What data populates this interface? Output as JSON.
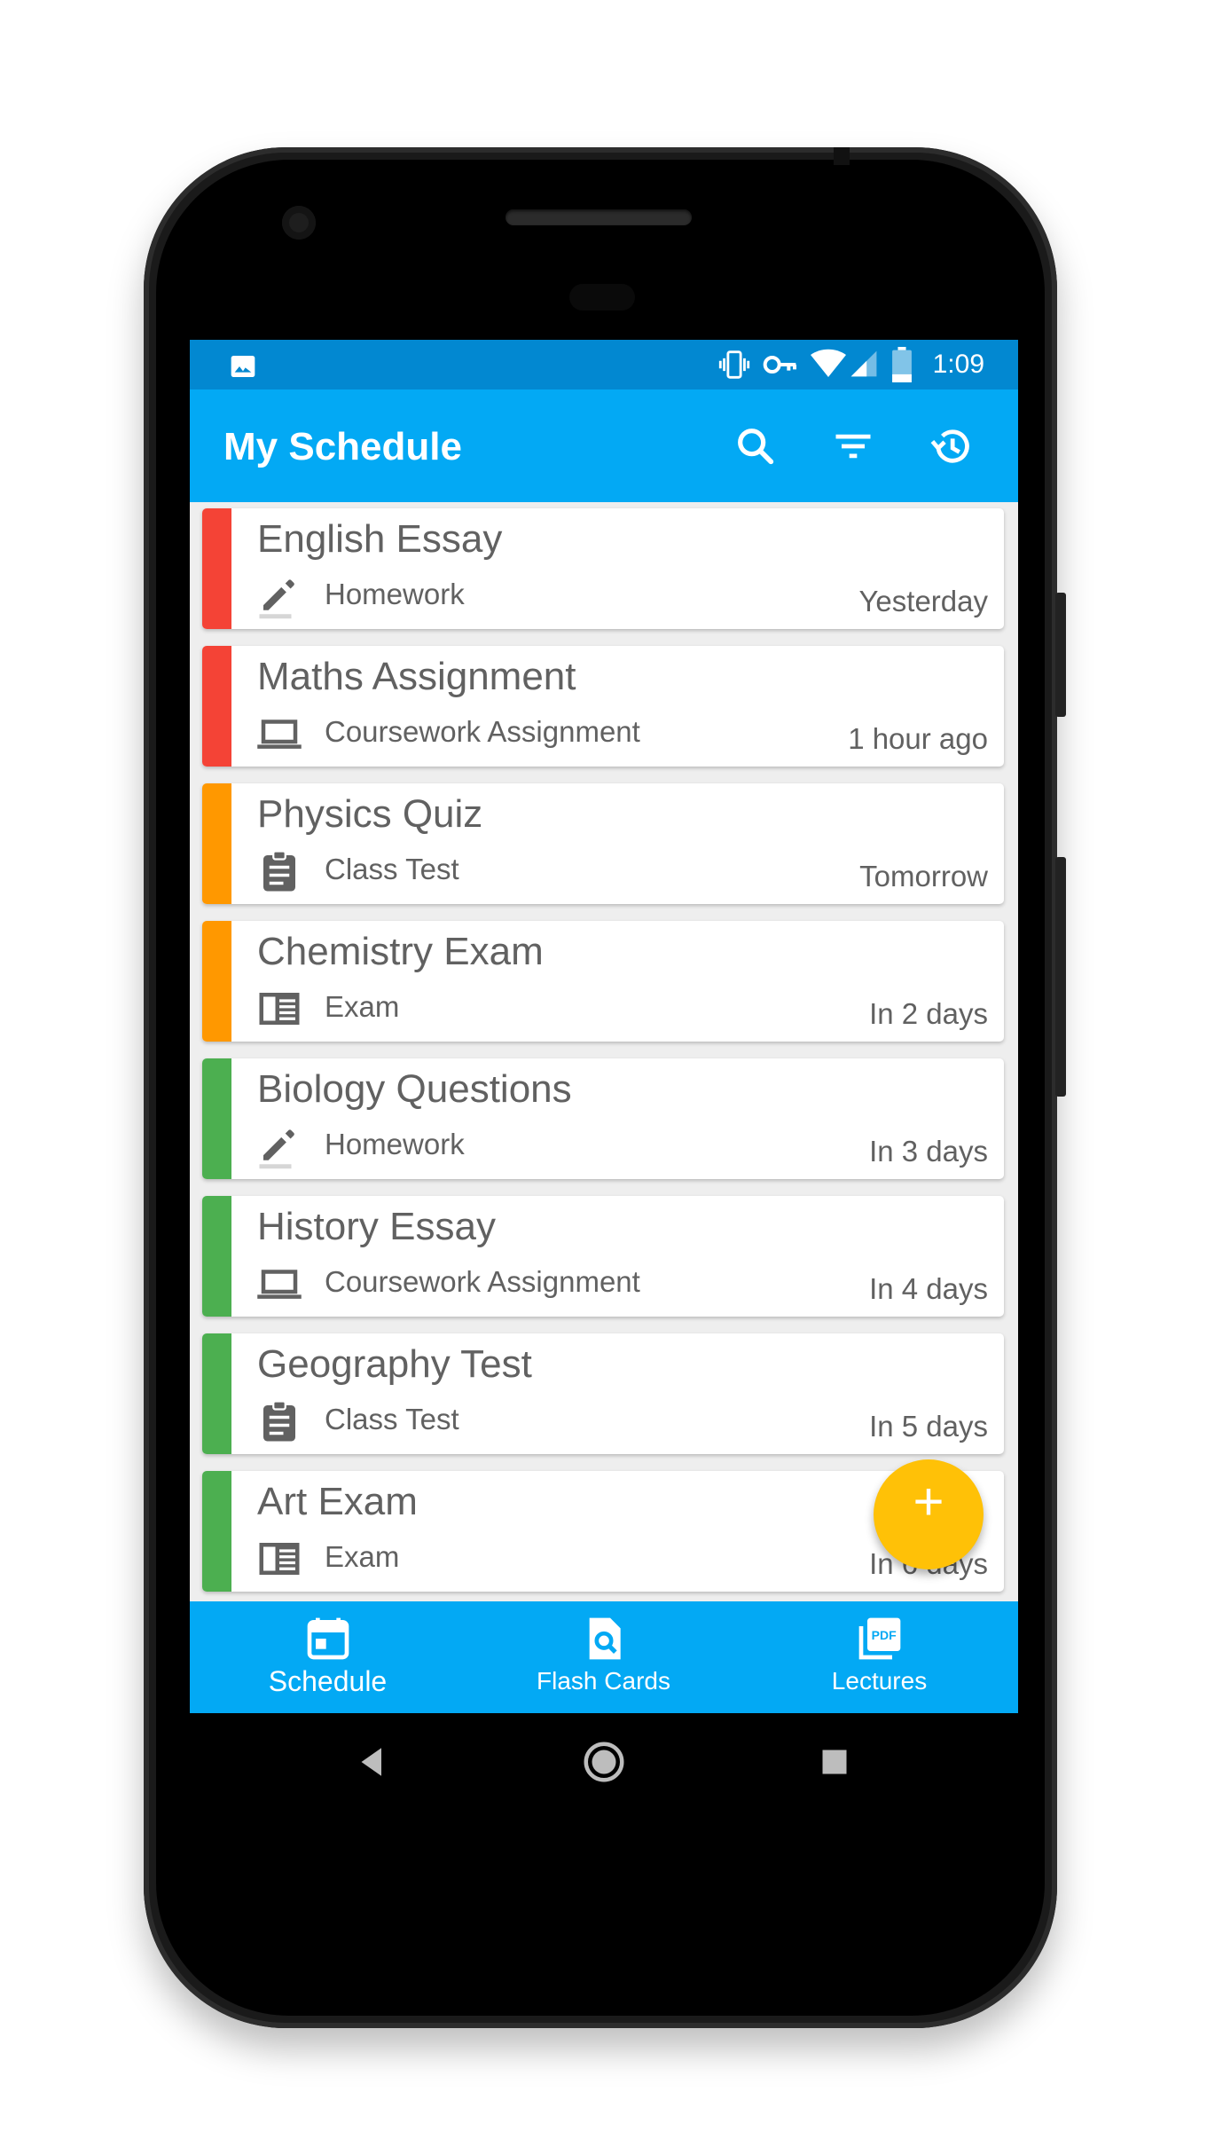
{
  "status_bar": {
    "time": "1:09",
    "icons": [
      "image-icon",
      "vibrate-icon",
      "vpn-key-icon",
      "wifi-icon",
      "signal-icon",
      "battery-icon"
    ]
  },
  "app_bar": {
    "title": "My Schedule",
    "actions": [
      "search-icon",
      "filter-icon",
      "history-icon"
    ]
  },
  "colors": {
    "primary": "#03a9f4",
    "primary_dark": "#0288d1",
    "accent": "#ffc107",
    "overdue": "#f44336",
    "soon": "#ff9800",
    "later": "#4caf50"
  },
  "schedule": [
    {
      "title": "English Essay",
      "type": "Homework",
      "icon": "pencil-icon",
      "when": "Yesterday",
      "color": "#f44336"
    },
    {
      "title": "Maths Assignment",
      "type": "Coursework Assignment",
      "icon": "laptop-icon",
      "when": "1 hour ago",
      "color": "#f44336"
    },
    {
      "title": "Physics Quiz",
      "type": "Class Test",
      "icon": "clipboard-icon",
      "when": "Tomorrow",
      "color": "#ff9800"
    },
    {
      "title": "Chemistry Exam",
      "type": "Exam",
      "icon": "newspaper-icon",
      "when": "In 2 days",
      "color": "#ff9800"
    },
    {
      "title": "Biology Questions",
      "type": "Homework",
      "icon": "pencil-icon",
      "when": "In 3 days",
      "color": "#4caf50"
    },
    {
      "title": "History Essay",
      "type": "Coursework Assignment",
      "icon": "laptop-icon",
      "when": "In 4 days",
      "color": "#4caf50"
    },
    {
      "title": "Geography Test",
      "type": "Class Test",
      "icon": "clipboard-icon",
      "when": "In 5 days",
      "color": "#4caf50"
    },
    {
      "title": "Art Exam",
      "type": "Exam",
      "icon": "newspaper-icon",
      "when": "In 6 days",
      "color": "#4caf50"
    }
  ],
  "fab": {
    "label": "+"
  },
  "bottom_nav": [
    {
      "label": "Schedule",
      "icon": "calendar-icon",
      "active": true
    },
    {
      "label": "Flash Cards",
      "icon": "find-in-page-icon",
      "active": false
    },
    {
      "label": "Lectures",
      "icon": "pdf-icon",
      "active": false
    }
  ],
  "system_nav": [
    "back-icon",
    "home-icon",
    "recents-icon"
  ]
}
